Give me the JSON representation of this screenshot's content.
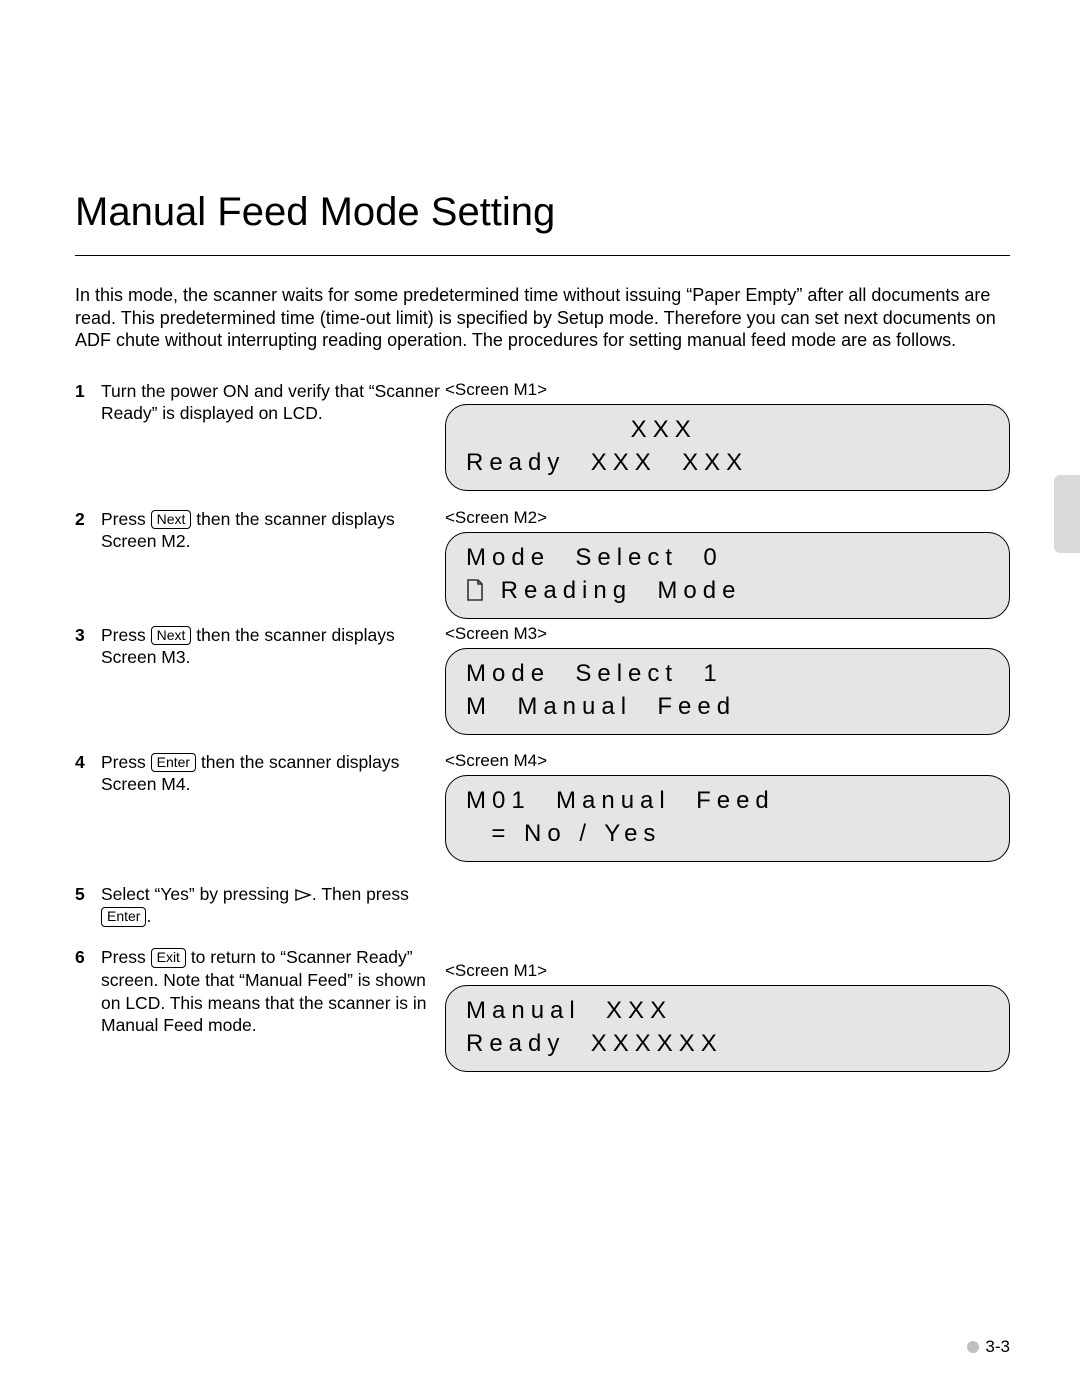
{
  "title": "Manual Feed Mode Setting",
  "intro": "In this mode, the scanner waits for some predetermined time without issuing “Paper Empty” after all documents are read. This predetermined time (time-out limit) is specified by Setup mode. Therefore you can set next documents on ADF chute without interrupting reading operation. The procedures for setting manual feed mode are as follows.",
  "keys": {
    "next": "Next",
    "enter": "Enter",
    "exit": "Exit"
  },
  "steps": {
    "s1": {
      "num": "1",
      "text": "Turn the power ON and verify that “Scanner Ready” is displayed on LCD."
    },
    "s2": {
      "num": "2",
      "text_a": "Press ",
      "text_b": " then the scanner displays Screen M2."
    },
    "s3": {
      "num": "3",
      "text_a": "Press ",
      "text_b": " then the scanner displays Screen M3."
    },
    "s4": {
      "num": "4",
      "text_a": "Press ",
      "text_b": " then the scanner displays Screen M4."
    },
    "s5": {
      "num": "5",
      "text_a": "Select “Yes” by pressing ",
      "text_b": ". Then press ",
      "text_c": "."
    },
    "s6": {
      "num": "6",
      "text_a": "Press ",
      "text_b": " to return to “Scanner Ready” screen. Note that “Manual Feed” is shown on LCD. This means that the scanner is in Manual Feed mode."
    }
  },
  "screens": {
    "m1a": {
      "label": "<Screen M1>",
      "line1": "             XXX",
      "line2": "Ready  XXX  XXX"
    },
    "m2": {
      "label": "<Screen M2>",
      "line1": "Mode  Select  0",
      "line2_after_icon": " Reading  Mode"
    },
    "m3": {
      "label": "<Screen M3>",
      "line1": "Mode  Select  1",
      "line2": "M  Manual  Feed"
    },
    "m4": {
      "label": "<Screen M4>",
      "line1": "M01  Manual  Feed",
      "line2": "  = No / Yes"
    },
    "m1b": {
      "label": "<Screen M1>",
      "line1": "Manual  XXX",
      "line2": "Ready  XXXXXX"
    }
  },
  "footer": "3-3"
}
